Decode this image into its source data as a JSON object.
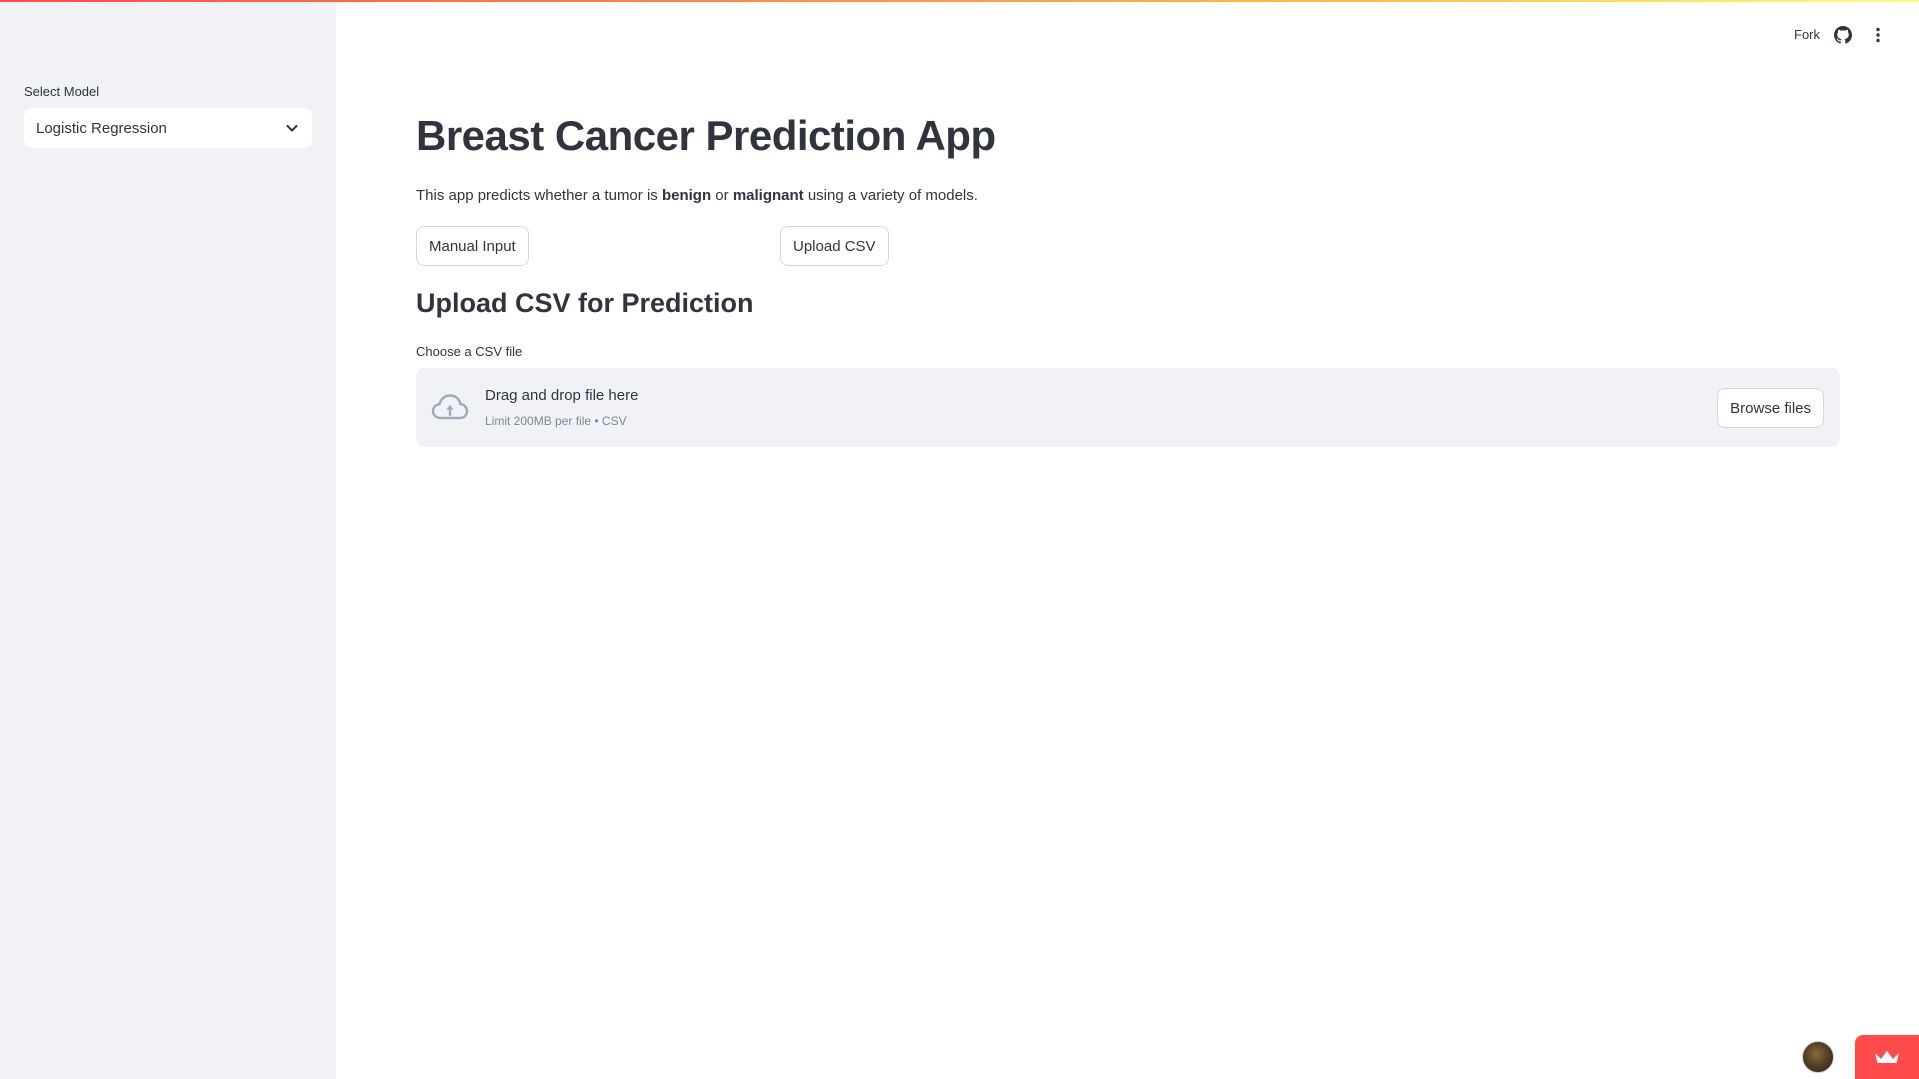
{
  "sidebar": {
    "select_label": "Select Model",
    "select_value": "Logistic Regression"
  },
  "header": {
    "fork_label": "Fork"
  },
  "main": {
    "title": "Breast Cancer Prediction App",
    "intro_prefix": "This app predicts whether a tumor is ",
    "intro_benign": "benign",
    "intro_or": " or ",
    "intro_malignant": "malignant",
    "intro_suffix": " using a variety of models.",
    "buttons": {
      "manual_input": "Manual Input",
      "upload_csv": "Upload CSV"
    },
    "section_title": "Upload CSV for Prediction",
    "uploader": {
      "label": "Choose a CSV file",
      "drop_title": "Drag and drop file here",
      "drop_subtitle": "Limit 200MB per file • CSV",
      "browse_label": "Browse files"
    }
  },
  "colors": {
    "accent": "#ff4b4b",
    "sidebar_bg": "#f0f2f6",
    "text": "#31333f",
    "muted": "#808495"
  },
  "icons": {
    "select_caret": "chevron-down-icon",
    "github": "github-icon",
    "menu": "more-vertical-icon",
    "upload": "cloud-upload-icon",
    "streamlit_crown": "crown-icon"
  }
}
